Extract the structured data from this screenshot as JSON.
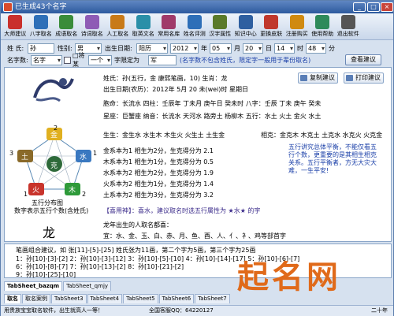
{
  "window": {
    "title": "已生成43个名字"
  },
  "toolbar": {
    "items": [
      {
        "label": "大师建议",
        "icon": "master-icon",
        "color": "#c9302c"
      },
      {
        "label": "八字取名",
        "icon": "bazi-icon",
        "color": "#2e6fb8"
      },
      {
        "label": "成语取名",
        "icon": "idiom-icon",
        "color": "#3a8c3a"
      },
      {
        "label": "诗词取名",
        "icon": "poem-icon",
        "color": "#8e5bb5"
      },
      {
        "label": "人工取名",
        "icon": "person-icon",
        "color": "#c87a18"
      },
      {
        "label": "取英文名",
        "icon": "english-icon",
        "color": "#2a8fa8"
      },
      {
        "label": "常用名库",
        "icon": "library-icon",
        "color": "#a03a6a"
      },
      {
        "label": "姓名评测",
        "icon": "evaluate-icon",
        "color": "#2e6fb8"
      },
      {
        "label": "汉字属性",
        "icon": "char-icon",
        "color": "#5a7a2a"
      },
      {
        "label": "知识中心",
        "icon": "knowledge-icon",
        "color": "#2e5fa0"
      },
      {
        "label": "更换皮肤",
        "icon": "skin-icon",
        "color": "#c0382c"
      },
      {
        "label": "注册购买",
        "icon": "register-icon",
        "color": "#d08a10"
      },
      {
        "label": "使用帮助",
        "icon": "help-icon",
        "color": "#2e8a5a"
      },
      {
        "label": "退出软件",
        "icon": "exit-icon",
        "color": "#555555"
      }
    ]
  },
  "form": {
    "surname_label": "姓 氏:",
    "surname_value": "孙",
    "gender_label": "性别:",
    "gender_value": "男",
    "birth_label": "出生日期:",
    "calendar_value": "阳历",
    "year_value": "2012",
    "year_unit": "年",
    "month_value": "05",
    "month_unit": "月",
    "day_value": "20",
    "day_unit": "日",
    "hour_value": "14",
    "hour_unit": "时",
    "minute_value": "48",
    "minute_unit": "分",
    "name_type_label": "名字数:",
    "name_type_value": "名字",
    "fixed_label": "□将某",
    "fixed_value": "一个",
    "fixed_char_label": "字限定为",
    "fixed_char_value": "军",
    "hint": "(名字数不包含姓氏，限定字一般用于辈份取名)",
    "view_button": "查看建议"
  },
  "info": {
    "name_line": "姓氏：孙(五行，金 康熙笔画，10)  生肖：龙",
    "birth_line": "出生日期(农历)：2012年 5月 20 未(wei)时  星期日",
    "copy_button": "复制建议",
    "print_button": "打印建议",
    "nayin_line": "胞命：长流水  四柱：壬辰年 丁未月 庚午日 癸未时  八字：壬辰 丁未 庚午 癸未",
    "star_line": "星座：巨蟹座  纳音：长流水 天河水 路旁土 杨柳木  五行：水土 火土 金火 水土",
    "wuxing_count": "生生：金生水 水生木 木生火 火生土 土生金",
    "ke_line": "相克：金克木 木克土 土克水 水克火 火克金",
    "lines": [
      "金系本为1 相生为2分，生克得分为 2.1",
      "木系本为1 相生为1分，生克得分为 0.5",
      "水系本为2 相生为2分，生克得分为 1.9",
      "火系本为2 相生为1分，生克得分为 1.4",
      "土系本为2 相生为3分，生克得分为 3.2"
    ],
    "element_diagram": {
      "metal": "金",
      "wood": "木",
      "water": "水",
      "fire": "火",
      "earth": "土",
      "center": "克",
      "numbers": [
        "2",
        "1",
        "2",
        "1",
        "3"
      ]
    },
    "diagram_caption": "五行分布图",
    "diagram_sub": "数字表示五行个数(含姓氏)",
    "advice_note": "五行讲究总体平衡，不能仅看五行个数，更重要的是其相生相克关系。五行平衡者，方无大灾大难，一生平安!",
    "useful_god": "【喜用神】：喜水，建议取名时选五行属性为 ★水★ 的字",
    "big_char": "龙",
    "zodiac_line": "龙年出生的人取名都喜：",
    "zodiac_chars": "宜：水、金、玉、白、赤、月、鱼、酉、人、亻、衤、鸡等部首字"
  },
  "lower": {
    "note": "笔画组合建议，如 张[11]-[5]-[25] 姓氏张为11画，第二个字为5画，第三个字为25画",
    "line1": "1：孙[10]-[3]-[2]   2：孙[10]-[3]-[12]   3：孙[10]-[5]-[10]   4：孙[10]-[14]-[17]   5：孙[10]-[6]-[7]",
    "line2": "6：孙[10]-[8]-[7]   7：孙[10]-[13]-[2]   8：孙[10]-[21]-[2]",
    "line3": "9：孙[10]-[25]-[10]"
  },
  "tabs1": [
    "TabSheet_bazqm",
    "TabSheet_qmjy"
  ],
  "tabs2": [
    "取名",
    "取名案例",
    "TabSheet3",
    "TabSheet4",
    "TabSheet5",
    "TabSheet6",
    "TabSheet7"
  ],
  "status": {
    "text": "用贵族宝宝取名软件，出生就高人一等！",
    "service": "全国客服QQ：64220127",
    "extra": "二十年"
  },
  "watermark": "起名网"
}
